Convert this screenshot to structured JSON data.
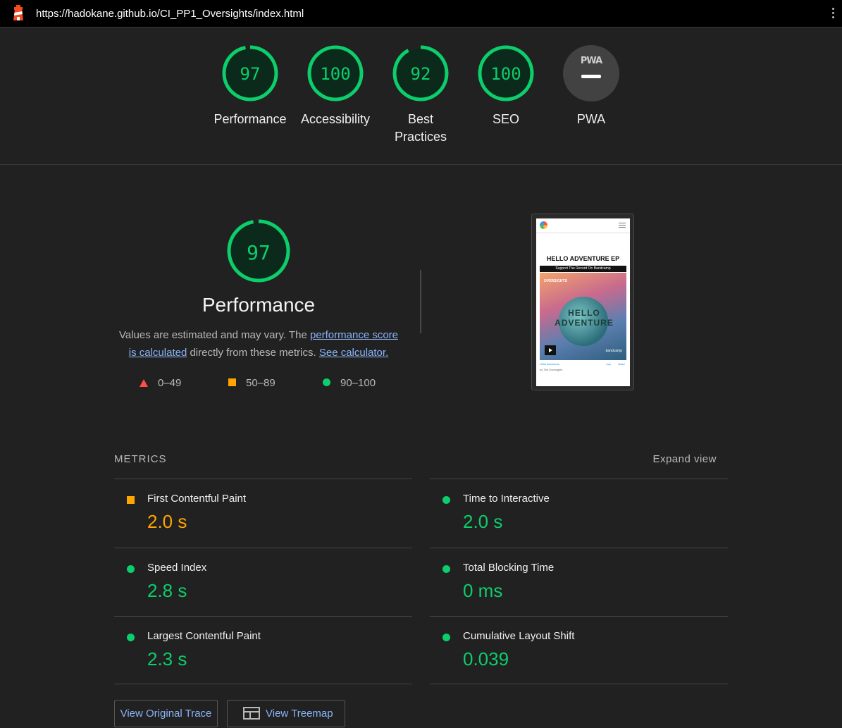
{
  "topbar": {
    "url": "https://hadokane.github.io/CI_PP1_Oversights/index.html"
  },
  "summary": {
    "gauges": [
      {
        "label": "Performance",
        "score": "97",
        "fraction": 0.97
      },
      {
        "label": "Accessibility",
        "score": "100",
        "fraction": 1.0
      },
      {
        "label": "Best Practices",
        "score": "92",
        "fraction": 0.92
      },
      {
        "label": "SEO",
        "score": "100",
        "fraction": 1.0
      }
    ],
    "pwa": {
      "label": "PWA",
      "badge": "PWA"
    }
  },
  "performance": {
    "score": "97",
    "fraction": 0.97,
    "title": "Performance",
    "desc_prefix": "Values are estimated and may vary. The ",
    "link_score": "performance score is calculated",
    "desc_middle": " directly from these metrics. ",
    "link_calc": "See calculator.",
    "legend": {
      "fail": "0–49",
      "average": "50–89",
      "pass": "90–100"
    }
  },
  "screenshot": {
    "title": "HELLO ADVENTURE EP",
    "band": "Support The Record On Bandcamp",
    "brand": "OVERSIGHTS",
    "art_text": "HELLO ADVENTURE",
    "bandcamp": "bandcamp",
    "track": "Hello Adventure",
    "by": "by The Oversights",
    "buy": "buy",
    "share": "share"
  },
  "metrics": {
    "heading": "METRICS",
    "expand": "Expand view",
    "items": [
      {
        "name": "First Contentful Paint",
        "value": "2.0 s",
        "rating": "average"
      },
      {
        "name": "Time to Interactive",
        "value": "2.0 s",
        "rating": "pass"
      },
      {
        "name": "Speed Index",
        "value": "2.8 s",
        "rating": "pass"
      },
      {
        "name": "Total Blocking Time",
        "value": "0 ms",
        "rating": "pass"
      },
      {
        "name": "Largest Contentful Paint",
        "value": "2.3 s",
        "rating": "pass"
      },
      {
        "name": "Cumulative Layout Shift",
        "value": "0.039",
        "rating": "pass"
      }
    ]
  },
  "buttons": {
    "trace": "View Original Trace",
    "treemap": "View Treemap"
  },
  "colors": {
    "pass": "#0cce6b",
    "average": "#ffa400",
    "fail": "#ff4e42",
    "background": "#212121"
  }
}
